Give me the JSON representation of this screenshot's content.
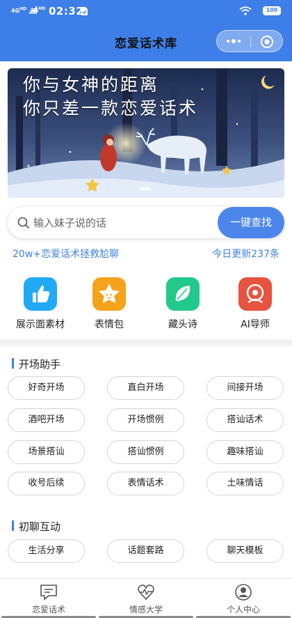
{
  "status": {
    "signal1": "4G",
    "signal2": "4G",
    "hd1": "HD",
    "hd2": "HD",
    "time": "02:32",
    "battery": "100"
  },
  "header": {
    "title": "恋爱话术库",
    "more_icon": "more-dots-icon",
    "close_icon": "target-circle-icon"
  },
  "banner": {
    "line1": "你与女神的距离",
    "line2": "你只差一款恋爱话术"
  },
  "search": {
    "placeholder": "输入妹子说的话",
    "button": "一键查找"
  },
  "info": {
    "left": "20w+恋爱话术拯救尬聊",
    "right": "今日更新237条"
  },
  "features": [
    {
      "label": "展示面素材",
      "icon": "thumbs-up-icon",
      "color": "#21a9f5"
    },
    {
      "label": "表情包",
      "icon": "star-face-icon",
      "color": "#f7a21b"
    },
    {
      "label": "藏头诗",
      "icon": "leaf-icon",
      "color": "#22c98a"
    },
    {
      "label": "AI导师",
      "icon": "ai-mentor-icon",
      "color": "#e6533f"
    }
  ],
  "sections": [
    {
      "title": "开场助手",
      "chips": [
        "好奇开场",
        "直白开场",
        "间接开场",
        "酒吧开场",
        "开场惯例",
        "搭讪话术",
        "场景搭讪",
        "搭讪惯例",
        "趣味搭讪",
        "收号后续",
        "表情话术",
        "土味情话"
      ]
    },
    {
      "title": "初聊互动",
      "chips": [
        "生活分享",
        "话题套路",
        "聊天模板"
      ]
    }
  ],
  "tabs": [
    {
      "label": "恋爱话术",
      "icon": "chat-bubble-icon"
    },
    {
      "label": "情感大学",
      "icon": "heart-pulse-icon"
    },
    {
      "label": "个人中心",
      "icon": "user-avatar-icon"
    }
  ]
}
